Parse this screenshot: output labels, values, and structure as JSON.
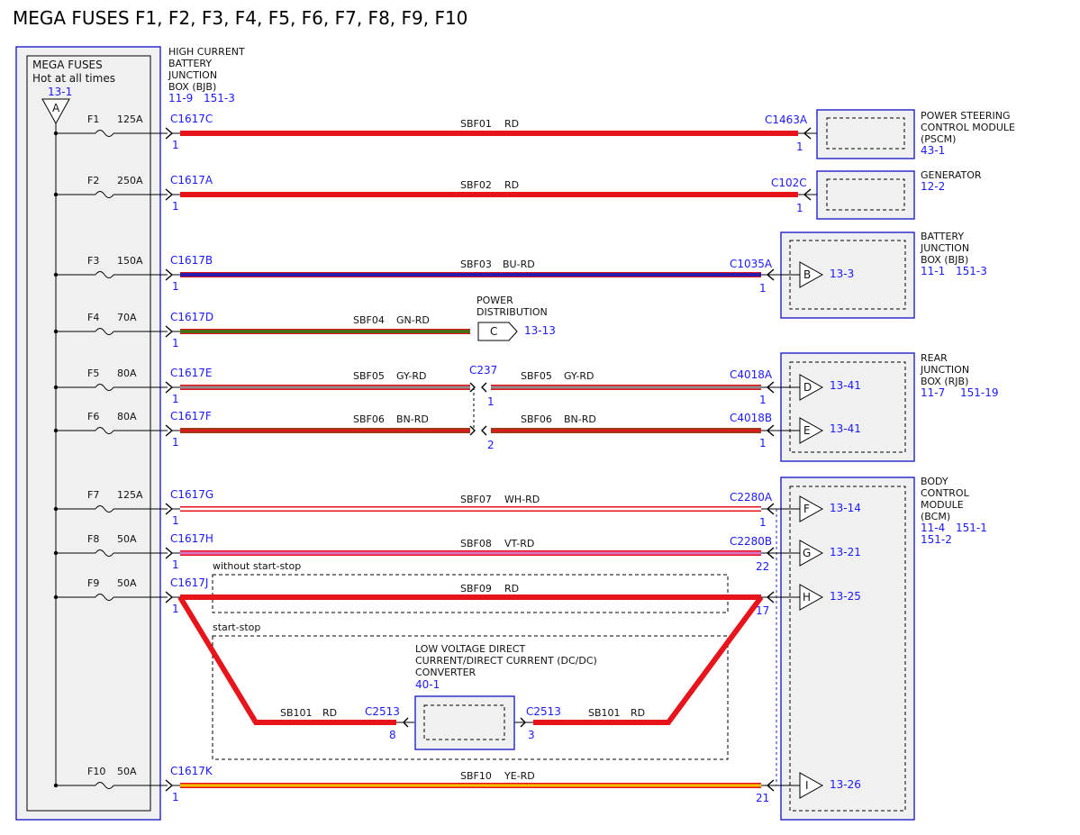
{
  "title": "MEGA FUSES F1, F2, F3, F4, F5, F6, F7, F8, F9, F10",
  "mega_box": {
    "label": "MEGA FUSES",
    "subtitle": "Hot at all times",
    "ref": "13-1",
    "connector": "A"
  },
  "bjb_header": {
    "line1": "HIGH CURRENT",
    "line2": "BATTERY",
    "line3": "JUNCTION",
    "line4": "BOX (BJB)",
    "ref1": "11-9",
    "ref2": "151-3"
  },
  "fuses": [
    {
      "name": "F1",
      "rating": "125A",
      "connector": "C1617C",
      "pin": "1",
      "circuit": "SBF01",
      "color": "RD"
    },
    {
      "name": "F2",
      "rating": "250A",
      "connector": "C1617A",
      "pin": "1",
      "circuit": "SBF02",
      "color": "RD"
    },
    {
      "name": "F3",
      "rating": "150A",
      "connector": "C1617B",
      "pin": "1",
      "circuit": "SBF03",
      "color": "BU-RD"
    },
    {
      "name": "F4",
      "rating": "70A",
      "connector": "C1617D",
      "pin": "1",
      "circuit": "SBF04",
      "color": "GN-RD"
    },
    {
      "name": "F5",
      "rating": "80A",
      "connector": "C1617E",
      "pin": "1",
      "circuit": "SBF05",
      "color": "GY-RD"
    },
    {
      "name": "F6",
      "rating": "80A",
      "connector": "C1617F",
      "pin": "1",
      "circuit": "SBF06",
      "color": "BN-RD"
    },
    {
      "name": "F7",
      "rating": "125A",
      "connector": "C1617G",
      "pin": "1",
      "circuit": "SBF07",
      "color": "WH-RD"
    },
    {
      "name": "F8",
      "rating": "50A",
      "connector": "C1617H",
      "pin": "1",
      "circuit": "SBF08",
      "color": "VT-RD"
    },
    {
      "name": "F9",
      "rating": "50A",
      "connector": "C1617J",
      "pin": "1",
      "circuit": "SBF09",
      "color": "RD"
    },
    {
      "name": "F10",
      "rating": "50A",
      "connector": "C1617K",
      "pin": "1",
      "circuit": "SBF10",
      "color": "YE-RD"
    }
  ],
  "far_connectors": {
    "f1": {
      "connector": "C1463A",
      "pin": "1"
    },
    "f2": {
      "connector": "C102C",
      "pin": "1"
    },
    "f3": {
      "connector": "C1035A",
      "pin": "1"
    },
    "f5": {
      "connector": "C4018A",
      "pin": "1"
    },
    "f6": {
      "connector": "C4018B",
      "pin": "1"
    },
    "f7": {
      "connector": "C2280A",
      "pin": "1"
    },
    "f8": {
      "connector": "C2280B",
      "pin": "22"
    },
    "f9": {
      "pin": "17"
    },
    "f10": {
      "pin": "21"
    }
  },
  "inline": {
    "connector": "C237",
    "pin_top": "1",
    "pin_bottom": "2",
    "circuit_top": "SBF05",
    "color_top": "GY-RD",
    "circuit_bottom": "SBF06",
    "color_bottom": "BN-RD"
  },
  "power_distribution": {
    "line1": "POWER",
    "line2": "DISTRIBUTION",
    "connector": "C",
    "ref": "13-13"
  },
  "pscm": {
    "line1": "POWER STEERING",
    "line2": "CONTROL MODULE",
    "line3": "(PSCM)",
    "ref": "43-1"
  },
  "generator": {
    "line1": "GENERATOR",
    "ref": "12-2"
  },
  "bjb": {
    "line1": "BATTERY",
    "line2": "JUNCTION",
    "line3": "BOX (BJB)",
    "ref1": "11-1",
    "ref2": "151-3",
    "connector": "B",
    "conn_ref": "13-3"
  },
  "rjb": {
    "line1": "REAR",
    "line2": "JUNCTION",
    "line3": "BOX (RJB)",
    "ref1": "11-7",
    "ref2": "151-19",
    "connectors": [
      {
        "letter": "D",
        "ref": "13-41"
      },
      {
        "letter": "E",
        "ref": "13-41"
      }
    ]
  },
  "bcm": {
    "line1": "BODY",
    "line2": "CONTROL",
    "line3": "MODULE",
    "line4": "(BCM)",
    "ref1": "11-4",
    "ref2": "151-1",
    "ref3": "151-2",
    "connectors": [
      {
        "letter": "F",
        "ref": "13-14"
      },
      {
        "letter": "G",
        "ref": "13-21"
      },
      {
        "letter": "H",
        "ref": "13-25"
      },
      {
        "letter": "I",
        "ref": "13-26"
      }
    ]
  },
  "variants": {
    "without": "without start-stop",
    "with": "start-stop"
  },
  "dcdc": {
    "line1": "LOW VOLTAGE DIRECT",
    "line2": "CURRENT/DIRECT CURRENT (DC/DC)",
    "line3": "CONVERTER",
    "ref": "40-1",
    "left_connector": "C2513",
    "left_pin": "8",
    "right_connector": "C2513",
    "right_pin": "3",
    "left_circuit": "SB101",
    "left_color": "RD",
    "right_circuit": "SB101",
    "right_color": "RD"
  },
  "wire_colors": {
    "RD": "#e8141c",
    "BU": "#2a1ab0",
    "GN": "#4b6b15",
    "GY": "#8c8c8c",
    "BN": "#9c3a1a",
    "WH": "#ffffff",
    "VT": "#e070c8",
    "YE": "#f3c300",
    "module_border": "#2222c8",
    "module_fill": "#f0f0f0"
  }
}
